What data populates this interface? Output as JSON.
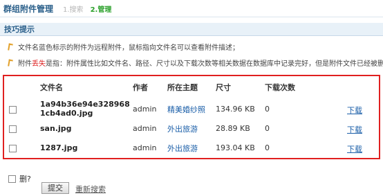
{
  "header": {
    "title": "群组附件管理",
    "step1": "1.搜索",
    "step2": "2.管理"
  },
  "tips": {
    "label": "技巧提示",
    "line1": "文件名蓝色标示的附件为远程附件，鼠标指向文件名可以查看附件描述；",
    "line2_pre": "附件",
    "line2_red": "丢失",
    "line2_post": "是指：附件属性比如文件名、路径、尺寸以及下载次数等相关数据在数据库中记录完好，但是附件文件已经被删除。"
  },
  "table": {
    "headers": {
      "filename": "文件名",
      "author": "作者",
      "topic": "所在主题",
      "size": "尺寸",
      "downloads": "下载次数"
    },
    "rows": [
      {
        "filename_line1": "1a94b36e94e328968",
        "filename_line2": "1cb4ad0.jpg",
        "author": "admin",
        "topic": "精美婚纱照",
        "size": "134.96 KB",
        "downloads": "0",
        "download_link": "下载"
      },
      {
        "filename_line1": "san.jpg",
        "filename_line2": "",
        "author": "admin",
        "topic": "外出旅游",
        "size": "28.89 KB",
        "downloads": "0",
        "download_link": "下载"
      },
      {
        "filename_line1": "1287.jpg",
        "filename_line2": "",
        "author": "admin",
        "topic": "外出旅游",
        "size": "193.04 KB",
        "downloads": "0",
        "download_link": "下载"
      }
    ]
  },
  "footer": {
    "delete_label": "删?",
    "submit_label": "提交",
    "reset_label": "重新搜索"
  }
}
